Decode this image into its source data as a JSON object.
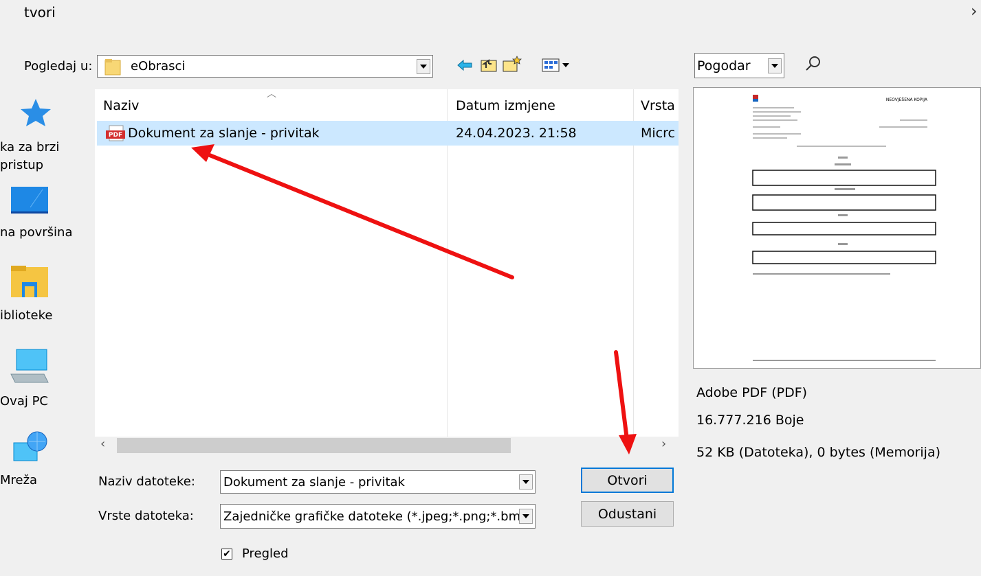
{
  "window": {
    "title": "tvori",
    "close_glyph": "✕"
  },
  "toolbar": {
    "look_in_label": "Pogledaj u:",
    "look_in_value": "eObrasci",
    "view_mode_value": "Pogodar"
  },
  "places": [
    {
      "label": "ka za brzi\npristup",
      "icon": "star-icon"
    },
    {
      "label": "na površina",
      "icon": "desktop-icon"
    },
    {
      "label": "iblioteke",
      "icon": "library-icon"
    },
    {
      "label": "Ovaj PC",
      "icon": "computer-icon"
    },
    {
      "label": "Mreža",
      "icon": "network-icon"
    }
  ],
  "columns": {
    "name": "Naziv",
    "date": "Datum izmjene",
    "type": "Vrsta"
  },
  "files": [
    {
      "name": "Dokument za slanje - privitak",
      "date": "24.04.2023. 21:58",
      "type": "Micrc"
    }
  ],
  "footer": {
    "filename_label": "Naziv datoteke:",
    "filename_value": "Dokument za slanje - privitak",
    "filetype_label": "Vrste datoteka:",
    "filetype_value": "Zajedničke grafičke datoteke (*.jpeg;*.png;*.bm",
    "open_label": "Otvori",
    "cancel_label": "Odustani",
    "preview_label": "Pregled",
    "preview_checked": true
  },
  "preview_info": {
    "format": "Adobe PDF (PDF)",
    "colors": "16.777.216 Boje",
    "size": "52 KB (Datoteka), 0 bytes (Memorija)",
    "doc_header": "NEOVJEŠENA KOPIJA"
  },
  "colors": {
    "selection": "#cce8ff",
    "annotation_arrow": "#ee1111",
    "accent": "#0078d7"
  }
}
